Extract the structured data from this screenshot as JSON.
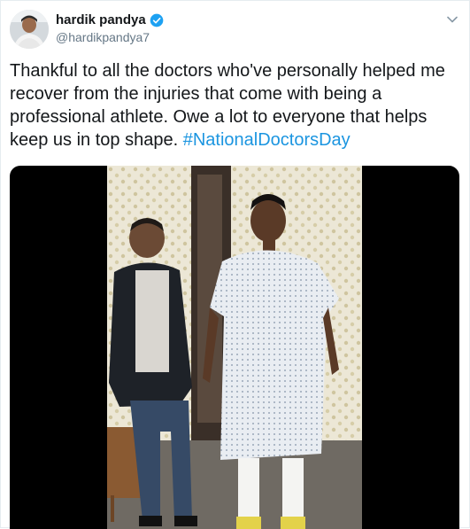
{
  "tweet": {
    "display_name": "hardik pandya",
    "handle": "@hardikpandya7",
    "text_part1": "Thankful to all the doctors who've personally helped me recover from the injuries that come with being a professional athlete. Owe a lot to everyone that helps keep us in top shape. ",
    "hashtag": "#NationalDoctorsDay",
    "icons": {
      "verified": "verified-badge-icon",
      "menu": "chevron-down-icon"
    }
  },
  "colors": {
    "text": "#14171a",
    "secondary": "#657786",
    "link": "#1b95e0",
    "verified": "#1da1f2"
  }
}
